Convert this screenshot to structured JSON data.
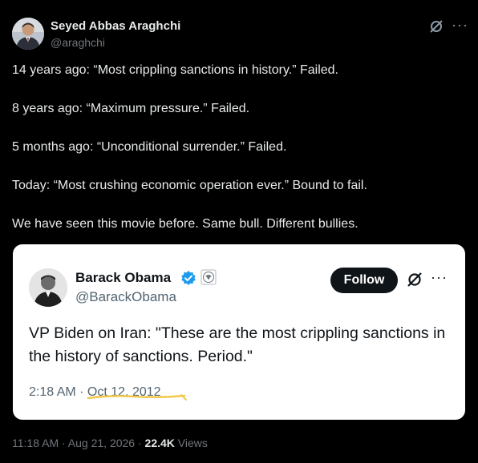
{
  "author": {
    "name": "Seyed Abbas Araghchi",
    "handle": "@araghchi"
  },
  "tweet": {
    "lines": [
      "14 years ago: “Most crippling sanctions in history.” Failed.",
      "8 years ago: “Maximum pressure.” Failed.",
      "5 months ago: “Unconditional surrender.” Failed.",
      "Today: “Most crushing economic operation ever.” Bound to fail.",
      "We have seen this movie before. Same bull. Different bullies."
    ]
  },
  "quote": {
    "name": "Barack Obama",
    "handle": "@BarackObama",
    "follow_label": "Follow",
    "text": "VP Biden on Iran: \"These are the most crippling sanctions in the history of sanctions. Period.\"",
    "time": "2:18 AM",
    "separator": " · ",
    "date": "Oct 12, 2012",
    "highlight_color": "#f2c94c"
  },
  "footer": {
    "time": "11:18 AM",
    "date": "Aug 21, 2026",
    "views_count": "22.4K",
    "views_label": "Views"
  },
  "colors": {
    "background": "#000000",
    "verified": "#1d9bf0"
  },
  "icons": [
    "grok-icon",
    "more-icon",
    "verified-badge-icon",
    "government-seal-icon"
  ]
}
